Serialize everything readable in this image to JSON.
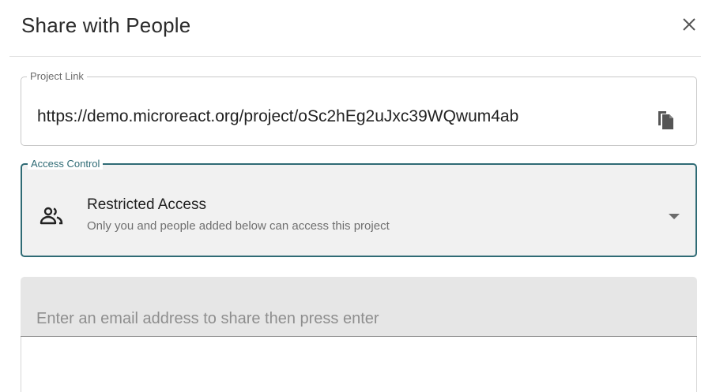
{
  "dialog": {
    "title": "Share with People",
    "close_icon": "close-icon"
  },
  "project_link": {
    "label": "Project Link",
    "value": "https://demo.microreact.org/project/oSc2hEg2uJxc39WQwum4ab",
    "copy_icon": "copy-icon"
  },
  "access_control": {
    "label": "Access Control",
    "selected": {
      "title": "Restricted Access",
      "description": "Only you and people added below can access this project",
      "icon": "people-icon"
    },
    "dropdown_icon": "arrow-drop-down-icon",
    "accent_color": "#2f6b75"
  },
  "email": {
    "placeholder": "Enter an email address to share then press enter",
    "value": ""
  }
}
